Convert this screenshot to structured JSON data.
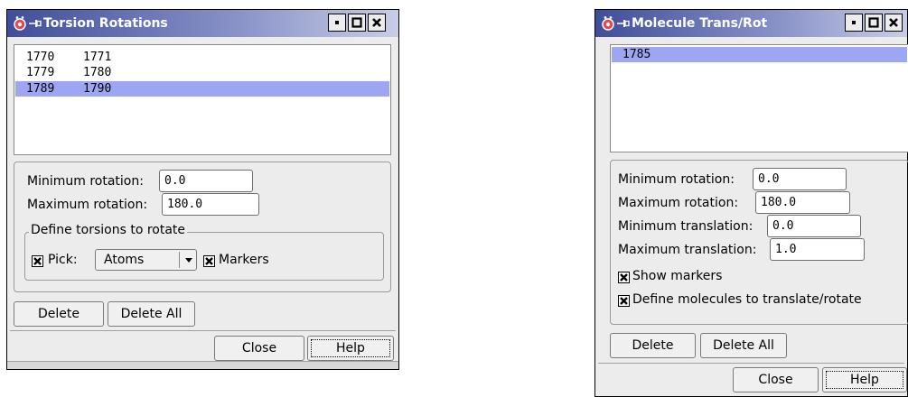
{
  "torsion": {
    "title": "Torsion Rotations",
    "rows": [
      {
        "a": "1770",
        "b": "1771",
        "selected": false
      },
      {
        "a": "1779",
        "b": "1780",
        "selected": false
      },
      {
        "a": "1789",
        "b": "1790",
        "selected": true
      }
    ],
    "min_rotation_label": "Minimum rotation:",
    "min_rotation_value": "0.0",
    "max_rotation_label": "Maximum rotation:",
    "max_rotation_value": "180.0",
    "group_label": "Define torsions to rotate",
    "pick_label": "Pick:",
    "pick_checked": true,
    "pick_value": "Atoms",
    "markers_label": "Markers",
    "markers_checked": true,
    "delete_label": "Delete",
    "delete_all_label": "Delete All",
    "close_label": "Close",
    "help_label": "Help"
  },
  "molecule": {
    "title": "Molecule Trans/Rot",
    "rows": [
      {
        "a": "1785",
        "selected": true
      }
    ],
    "min_rotation_label": "Minimum rotation:",
    "min_rotation_value": "0.0",
    "max_rotation_label": "Maximum rotation:",
    "max_rotation_value": "180.0",
    "min_translation_label": "Minimum translation:",
    "min_translation_value": "0.0",
    "max_translation_label": "Maximum translation:",
    "max_translation_value": "1.0",
    "show_markers_label": "Show markers",
    "show_markers_checked": true,
    "define_label": "Define molecules to translate/rotate",
    "define_checked": true,
    "delete_label": "Delete",
    "delete_all_label": "Delete All",
    "close_label": "Close",
    "help_label": "Help"
  },
  "icons": {
    "app": "app-icon",
    "pin": "pin-icon",
    "minimize": "minimize-icon",
    "maximize": "maximize-icon",
    "close": "close-icon",
    "check": "checkmark-icon",
    "dropdown": "chevron-down-icon"
  },
  "colors": {
    "titlebar_start": "#3f4e9a",
    "titlebar_end": "#c8cde6",
    "selection": "#9da6f3",
    "window_bg": "#ececec"
  }
}
